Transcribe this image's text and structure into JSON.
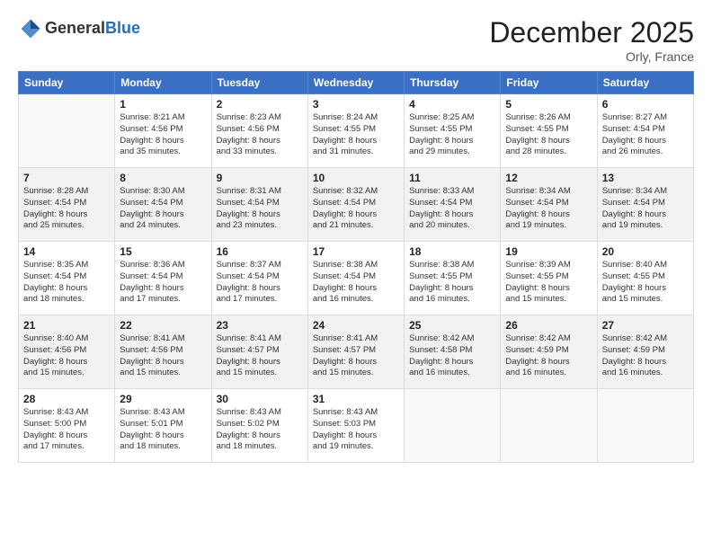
{
  "header": {
    "logo_general": "General",
    "logo_blue": "Blue",
    "month_title": "December 2025",
    "location": "Orly, France"
  },
  "weekdays": [
    "Sunday",
    "Monday",
    "Tuesday",
    "Wednesday",
    "Thursday",
    "Friday",
    "Saturday"
  ],
  "weeks": [
    [
      {
        "day": "",
        "info": ""
      },
      {
        "day": "1",
        "info": "Sunrise: 8:21 AM\nSunset: 4:56 PM\nDaylight: 8 hours\nand 35 minutes."
      },
      {
        "day": "2",
        "info": "Sunrise: 8:23 AM\nSunset: 4:56 PM\nDaylight: 8 hours\nand 33 minutes."
      },
      {
        "day": "3",
        "info": "Sunrise: 8:24 AM\nSunset: 4:55 PM\nDaylight: 8 hours\nand 31 minutes."
      },
      {
        "day": "4",
        "info": "Sunrise: 8:25 AM\nSunset: 4:55 PM\nDaylight: 8 hours\nand 29 minutes."
      },
      {
        "day": "5",
        "info": "Sunrise: 8:26 AM\nSunset: 4:55 PM\nDaylight: 8 hours\nand 28 minutes."
      },
      {
        "day": "6",
        "info": "Sunrise: 8:27 AM\nSunset: 4:54 PM\nDaylight: 8 hours\nand 26 minutes."
      }
    ],
    [
      {
        "day": "7",
        "info": "Sunrise: 8:28 AM\nSunset: 4:54 PM\nDaylight: 8 hours\nand 25 minutes."
      },
      {
        "day": "8",
        "info": "Sunrise: 8:30 AM\nSunset: 4:54 PM\nDaylight: 8 hours\nand 24 minutes."
      },
      {
        "day": "9",
        "info": "Sunrise: 8:31 AM\nSunset: 4:54 PM\nDaylight: 8 hours\nand 23 minutes."
      },
      {
        "day": "10",
        "info": "Sunrise: 8:32 AM\nSunset: 4:54 PM\nDaylight: 8 hours\nand 21 minutes."
      },
      {
        "day": "11",
        "info": "Sunrise: 8:33 AM\nSunset: 4:54 PM\nDaylight: 8 hours\nand 20 minutes."
      },
      {
        "day": "12",
        "info": "Sunrise: 8:34 AM\nSunset: 4:54 PM\nDaylight: 8 hours\nand 19 minutes."
      },
      {
        "day": "13",
        "info": "Sunrise: 8:34 AM\nSunset: 4:54 PM\nDaylight: 8 hours\nand 19 minutes."
      }
    ],
    [
      {
        "day": "14",
        "info": "Sunrise: 8:35 AM\nSunset: 4:54 PM\nDaylight: 8 hours\nand 18 minutes."
      },
      {
        "day": "15",
        "info": "Sunrise: 8:36 AM\nSunset: 4:54 PM\nDaylight: 8 hours\nand 17 minutes."
      },
      {
        "day": "16",
        "info": "Sunrise: 8:37 AM\nSunset: 4:54 PM\nDaylight: 8 hours\nand 17 minutes."
      },
      {
        "day": "17",
        "info": "Sunrise: 8:38 AM\nSunset: 4:54 PM\nDaylight: 8 hours\nand 16 minutes."
      },
      {
        "day": "18",
        "info": "Sunrise: 8:38 AM\nSunset: 4:55 PM\nDaylight: 8 hours\nand 16 minutes."
      },
      {
        "day": "19",
        "info": "Sunrise: 8:39 AM\nSunset: 4:55 PM\nDaylight: 8 hours\nand 15 minutes."
      },
      {
        "day": "20",
        "info": "Sunrise: 8:40 AM\nSunset: 4:55 PM\nDaylight: 8 hours\nand 15 minutes."
      }
    ],
    [
      {
        "day": "21",
        "info": "Sunrise: 8:40 AM\nSunset: 4:56 PM\nDaylight: 8 hours\nand 15 minutes."
      },
      {
        "day": "22",
        "info": "Sunrise: 8:41 AM\nSunset: 4:56 PM\nDaylight: 8 hours\nand 15 minutes."
      },
      {
        "day": "23",
        "info": "Sunrise: 8:41 AM\nSunset: 4:57 PM\nDaylight: 8 hours\nand 15 minutes."
      },
      {
        "day": "24",
        "info": "Sunrise: 8:41 AM\nSunset: 4:57 PM\nDaylight: 8 hours\nand 15 minutes."
      },
      {
        "day": "25",
        "info": "Sunrise: 8:42 AM\nSunset: 4:58 PM\nDaylight: 8 hours\nand 16 minutes."
      },
      {
        "day": "26",
        "info": "Sunrise: 8:42 AM\nSunset: 4:59 PM\nDaylight: 8 hours\nand 16 minutes."
      },
      {
        "day": "27",
        "info": "Sunrise: 8:42 AM\nSunset: 4:59 PM\nDaylight: 8 hours\nand 16 minutes."
      }
    ],
    [
      {
        "day": "28",
        "info": "Sunrise: 8:43 AM\nSunset: 5:00 PM\nDaylight: 8 hours\nand 17 minutes."
      },
      {
        "day": "29",
        "info": "Sunrise: 8:43 AM\nSunset: 5:01 PM\nDaylight: 8 hours\nand 18 minutes."
      },
      {
        "day": "30",
        "info": "Sunrise: 8:43 AM\nSunset: 5:02 PM\nDaylight: 8 hours\nand 18 minutes."
      },
      {
        "day": "31",
        "info": "Sunrise: 8:43 AM\nSunset: 5:03 PM\nDaylight: 8 hours\nand 19 minutes."
      },
      {
        "day": "",
        "info": ""
      },
      {
        "day": "",
        "info": ""
      },
      {
        "day": "",
        "info": ""
      }
    ]
  ]
}
